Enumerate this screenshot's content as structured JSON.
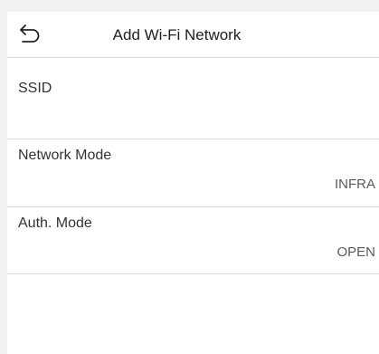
{
  "header": {
    "title": "Add Wi-Fi Network",
    "back_icon": "back-arrow-icon"
  },
  "fields": [
    {
      "label": "SSID",
      "value": ""
    },
    {
      "label": "Network Mode",
      "value": "INFRA"
    },
    {
      "label": "Auth. Mode",
      "value": "OPEN"
    }
  ]
}
